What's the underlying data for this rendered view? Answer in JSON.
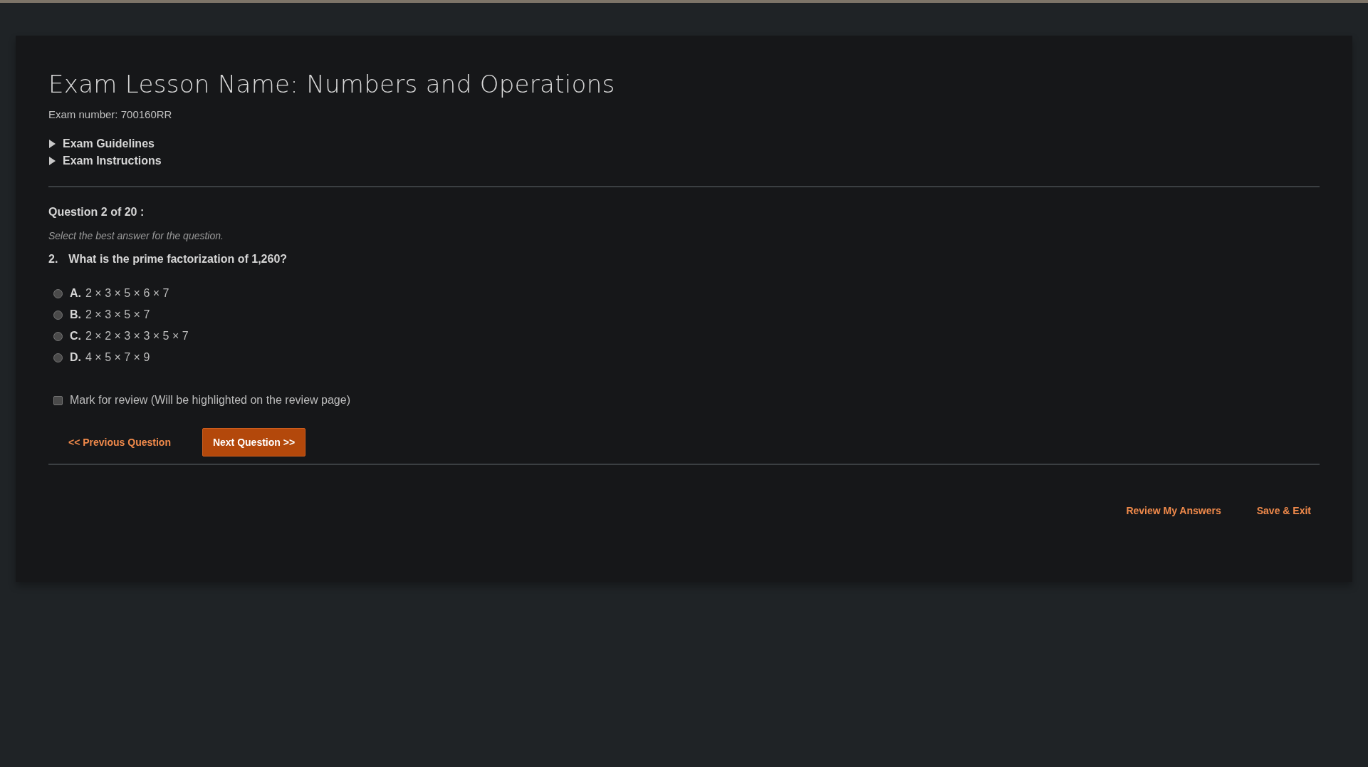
{
  "exam": {
    "title": "Exam Lesson Name: Numbers and Operations",
    "number": "Exam number: 700160RR"
  },
  "sections": [
    {
      "label": "Exam Guidelines",
      "expanded": false
    },
    {
      "label": "Exam Instructions",
      "expanded": false
    }
  ],
  "question": {
    "heading": "Question 2 of 20 :",
    "instruction": "Select the best answer for the question.",
    "number": "2.",
    "text": "What is the prime factorization of 1,260?",
    "options": [
      {
        "letter": "A.",
        "text": "2 × 3 × 5 × 6 × 7",
        "selected": false
      },
      {
        "letter": "B.",
        "text": "2 × 3 × 5 × 7",
        "selected": false
      },
      {
        "letter": "C.",
        "text": "2 × 2 × 3 × 3 × 5 × 7",
        "selected": false
      },
      {
        "letter": "D.",
        "text": "4 × 5 × 7 × 9",
        "selected": false
      }
    ],
    "review": {
      "label": "Mark for review (Will be highlighted on the review page)",
      "checked": false
    }
  },
  "nav": {
    "previous": "<< Previous Question",
    "next": "Next Question >>"
  },
  "footer": [
    "Review My Answers",
    "Save & Exit"
  ]
}
